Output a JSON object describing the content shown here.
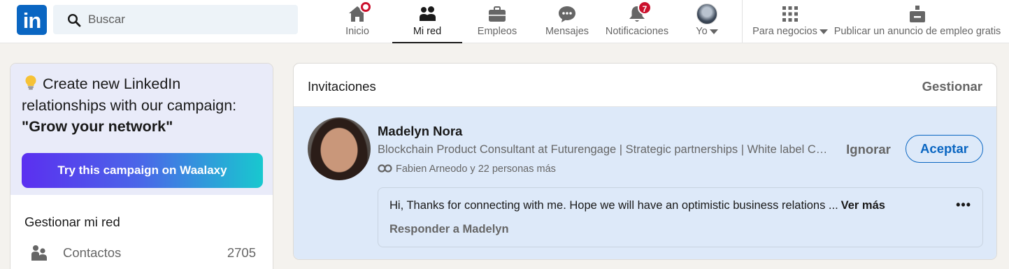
{
  "topnav": {
    "logo_text": "in",
    "search": {
      "placeholder": "Buscar"
    },
    "items": [
      {
        "label": "Inicio",
        "icon": "home-icon",
        "badge": ""
      },
      {
        "label": "Mi red",
        "icon": "network-icon",
        "active": true
      },
      {
        "label": "Empleos",
        "icon": "briefcase-icon"
      },
      {
        "label": "Mensajes",
        "icon": "messaging-icon"
      },
      {
        "label": "Notificaciones",
        "icon": "bell-icon",
        "badge": "7"
      },
      {
        "label": "Yo",
        "icon": "avatar"
      }
    ],
    "business": {
      "label": "Para negocios",
      "icon": "grid-icon"
    },
    "post_job": {
      "label": "Publicar un anuncio de empleo gratis",
      "icon": "post-job-icon"
    }
  },
  "promo": {
    "icon": "lightbulb-icon",
    "line1": "Create new LinkedIn relationships with our campaign:",
    "highlight": "\"Grow your network\"",
    "button_label": "Try this campaign on Waalaxy",
    "gradient": [
      "#5b2ff0",
      "#18c8cf"
    ]
  },
  "manage_network": {
    "title": "Gestionar mi red",
    "items": [
      {
        "label": "Contactos",
        "count": "2705",
        "icon": "contacts-icon"
      }
    ]
  },
  "invitations": {
    "title": "Invitaciones",
    "manage_label": "Gestionar",
    "item": {
      "name": "Madelyn Nora",
      "headline": "Blockchain Product Consultant at Futurengage | Strategic partnerships | White label Crypto Exchange",
      "mutual": "Fabien Arneodo y 22 personas más",
      "ignore_label": "Ignorar",
      "accept_label": "Aceptar",
      "message": "Hi, Thanks for connecting with me. Hope we will have an optimistic business relations ...",
      "see_more": "Ver más",
      "reply_label": "Responder a Madelyn"
    }
  },
  "colors": {
    "brand": "#0a66c2",
    "badge": "#cb112d",
    "invitation_bg": "#dde9f9",
    "promo_bg": "#e9ebf9"
  }
}
